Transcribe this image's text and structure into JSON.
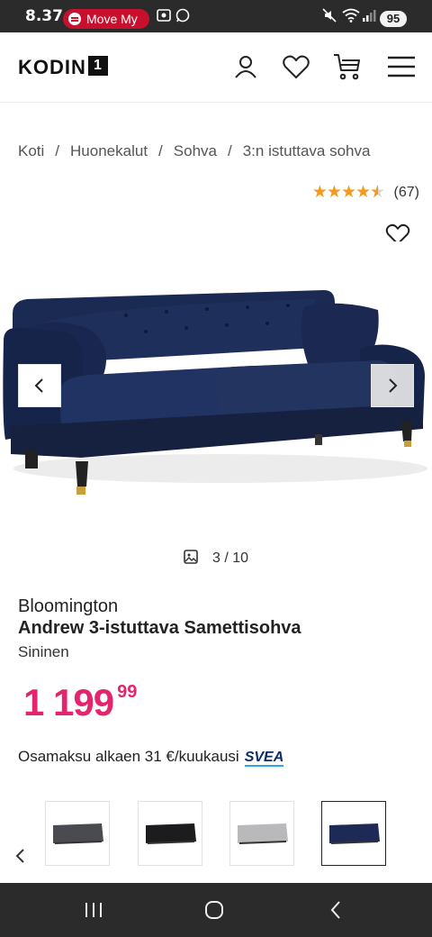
{
  "status_bar": {
    "time": "8.37",
    "media_label": "Move My",
    "battery": "95",
    "icons": [
      "spotify-icon",
      "screenshot-icon",
      "whatsapp-icon",
      "mute-icon",
      "wifi-icon",
      "signal-icon"
    ]
  },
  "header": {
    "logo_text": "KODIN",
    "logo_box": "1",
    "icons": [
      "account-icon",
      "heart-icon",
      "cart-icon",
      "menu-icon"
    ]
  },
  "breadcrumb": [
    "Koti",
    "Huonekalut",
    "Sohva",
    "3:n istuttava sohva"
  ],
  "breadcrumb_separator": "/",
  "rating": {
    "stars": 4.5,
    "count": "(67)"
  },
  "gallery": {
    "counter": "3 / 10",
    "colors": {
      "sofa": "#16244a",
      "leg": "#222222",
      "castor": "#c9a038"
    }
  },
  "product": {
    "brand": "Bloomington",
    "title": "Andrew 3-istuttava Samettisohva",
    "color": "Sininen",
    "price_main": "1 199",
    "price_cents": "99",
    "installment": "Osamaksu alkaen 31 €/kuukausi",
    "installment_provider": "SVEA"
  },
  "variants": [
    {
      "color": "#4a4b50"
    },
    {
      "color": "#1c1c1e"
    },
    {
      "color": "#b9b9bb"
    },
    {
      "color": "#1c2a55",
      "selected": true
    }
  ],
  "colors": {
    "accent": "#e4256d",
    "star": "#f29b1d",
    "status_bar": "#2b2b2b"
  }
}
